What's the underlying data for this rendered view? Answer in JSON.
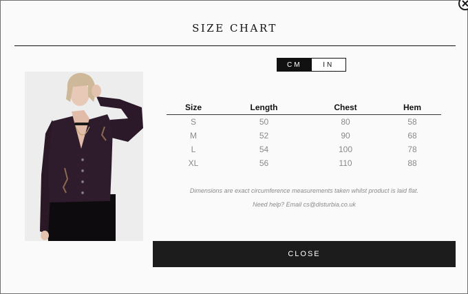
{
  "modal": {
    "title": "SIZE CHART",
    "close_icon": "close-x-icon",
    "close_button_label": "CLOSE"
  },
  "units": {
    "options": [
      "CM",
      "IN"
    ],
    "selected": "CM"
  },
  "product_photo": {
    "description_icon": "product-model-photo"
  },
  "table": {
    "headers": [
      "Size",
      "Length",
      "Chest",
      "Hem"
    ],
    "rows": [
      [
        "S",
        "50",
        "80",
        "58"
      ],
      [
        "M",
        "52",
        "90",
        "68"
      ],
      [
        "L",
        "54",
        "100",
        "78"
      ],
      [
        "XL",
        "56",
        "110",
        "88"
      ]
    ]
  },
  "notes": {
    "measurement": "Dimensions are exact circumference measurements taken whilst product is laid flat.",
    "help": "Need help? Email cs@disturbia.co.uk"
  }
}
